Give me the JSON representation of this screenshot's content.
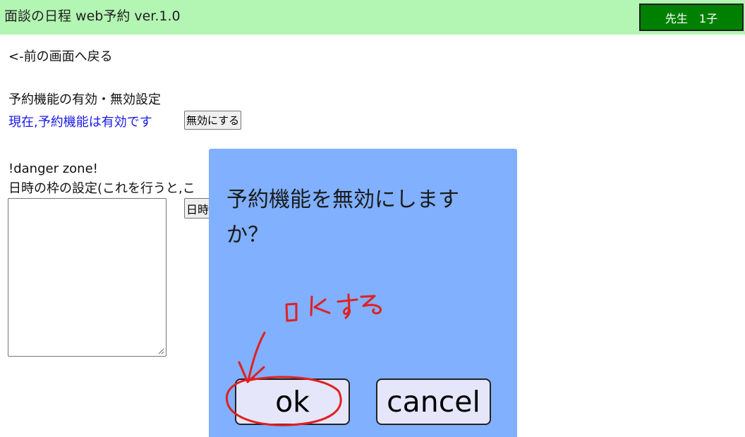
{
  "header": {
    "app_title": "面談の日程 web予約 ver.1.0",
    "user_badge": "先生　1子",
    "colors": {
      "header_bg": "#b3f5b3",
      "badge_bg": "#008000"
    }
  },
  "main": {
    "back_link": "<-前の画面へ戻る",
    "reservation_section": {
      "title": "予約機能の有効・無効設定",
      "status": "現在,予約機能は有効です",
      "toggle_button": "無効にする"
    },
    "danger_section": {
      "title": "!danger zone!",
      "description": "日時の枠の設定(これを行うと,こ",
      "textarea_value": "",
      "apply_button": "日時"
    }
  },
  "dialog": {
    "message": "予約機能を無効にしますか？",
    "ok_label": "ok",
    "cancel_label": "cancel",
    "colors": {
      "dialog_bg": "#80b0ff",
      "button_bg": "#e6e6fa"
    }
  },
  "annotation": {
    "handwritten_note": "OKする",
    "color": "#e02020"
  }
}
